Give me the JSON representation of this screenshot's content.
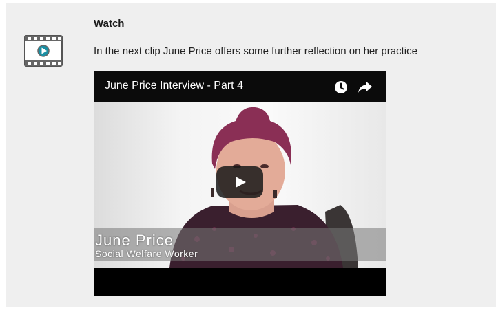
{
  "section": {
    "title": "Watch",
    "intro": "In the next clip June Price offers some further reflection on her practice",
    "icon": "film-icon"
  },
  "video": {
    "title": "June Price Interview - Part 4",
    "icons": [
      "clock-icon",
      "share-icon",
      "play-icon"
    ],
    "caption": {
      "name": "June Price",
      "role": "Social Welfare Worker"
    }
  },
  "colors": {
    "panel_bg": "#efefef",
    "video_bar": "#0b0b0b",
    "hair": "#8a2f55",
    "top": "#3a1f2e"
  }
}
